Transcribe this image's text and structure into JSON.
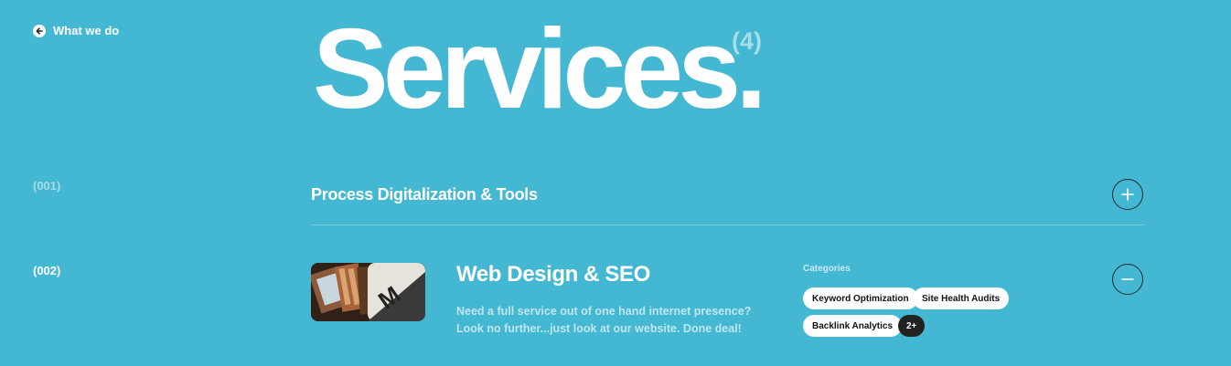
{
  "header": {
    "back_label": "What we do",
    "title": "Services.",
    "count": "(4)"
  },
  "services": [
    {
      "number": "(001)",
      "title": "Process Digitalization & Tools",
      "state": "collapsed",
      "icon": "plus-icon"
    },
    {
      "number": "(002)",
      "title": "Web Design & SEO",
      "state": "expanded",
      "icon": "minus-icon",
      "description": "Need a full service out of one hand internet presence? Look no further...just look at our website. Done deal!",
      "categories_label": "Categories",
      "categories": [
        "Keyword Optimization",
        "Site Health Audits",
        "Backlink Analytics"
      ],
      "more": "2+"
    }
  ],
  "colors": {
    "background": "#44b8d2",
    "text": "#ffffff",
    "muted": "#a7dde9",
    "button_border": "#1d2a30",
    "chip_dark": "#222222"
  }
}
